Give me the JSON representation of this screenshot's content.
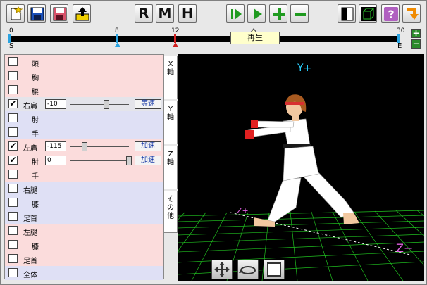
{
  "toolbar": {
    "buttons": [
      {
        "name": "new-button",
        "icon": "new-file-icon"
      },
      {
        "name": "save-button",
        "icon": "floppy-disk-icon"
      },
      {
        "name": "save-as-button",
        "icon": "floppy-disk-red-icon"
      },
      {
        "name": "export-button",
        "icon": "export-arrow-icon"
      }
    ],
    "mode_r": "R",
    "mode_m": "M",
    "mode_h": "H"
  },
  "timeline": {
    "ticks": [
      "0",
      "8",
      "12",
      "30"
    ],
    "start_label": "S",
    "end_label": "E",
    "tooltip": "再生",
    "current_frame": 8,
    "max_frame": 30
  },
  "joints": [
    {
      "label": "頭",
      "checked": false,
      "color": "pink"
    },
    {
      "label": "胸",
      "checked": false,
      "color": "pink"
    },
    {
      "label": "腰",
      "checked": false,
      "color": "pink"
    },
    {
      "label": "右肩",
      "checked": true,
      "color": "selected",
      "value": "-10",
      "mode": "等速"
    },
    {
      "label": "肘",
      "checked": false,
      "color": "blue"
    },
    {
      "label": "手",
      "checked": false,
      "color": "blue"
    },
    {
      "label": "左肩",
      "checked": true,
      "color": "pink",
      "value": "-115",
      "mode": "加速"
    },
    {
      "label": "肘",
      "checked": true,
      "color": "pink",
      "value": "0",
      "mode": "加速"
    },
    {
      "label": "手",
      "checked": false,
      "color": "pink"
    },
    {
      "label": "右腿",
      "checked": false,
      "color": "blue"
    },
    {
      "label": "膝",
      "checked": false,
      "color": "blue"
    },
    {
      "label": "足首",
      "checked": false,
      "color": "blue"
    },
    {
      "label": "左腿",
      "checked": false,
      "color": "pink"
    },
    {
      "label": "膝",
      "checked": false,
      "color": "pink"
    },
    {
      "label": "足首",
      "checked": false,
      "color": "pink"
    },
    {
      "label": "全体",
      "checked": false,
      "color": "blue"
    }
  ],
  "axis_tabs": [
    "X軸",
    "Y軸",
    "Z軸",
    "その他"
  ],
  "viewport": {
    "y_label": "Y+",
    "z_plus_label": "Z+",
    "z_minus_label": "Z−"
  },
  "colors": {
    "grid": "#20c020",
    "axis_y": "#2ad0ff",
    "axis_z": "#e060e0",
    "play_green": "#1f9a1f"
  }
}
